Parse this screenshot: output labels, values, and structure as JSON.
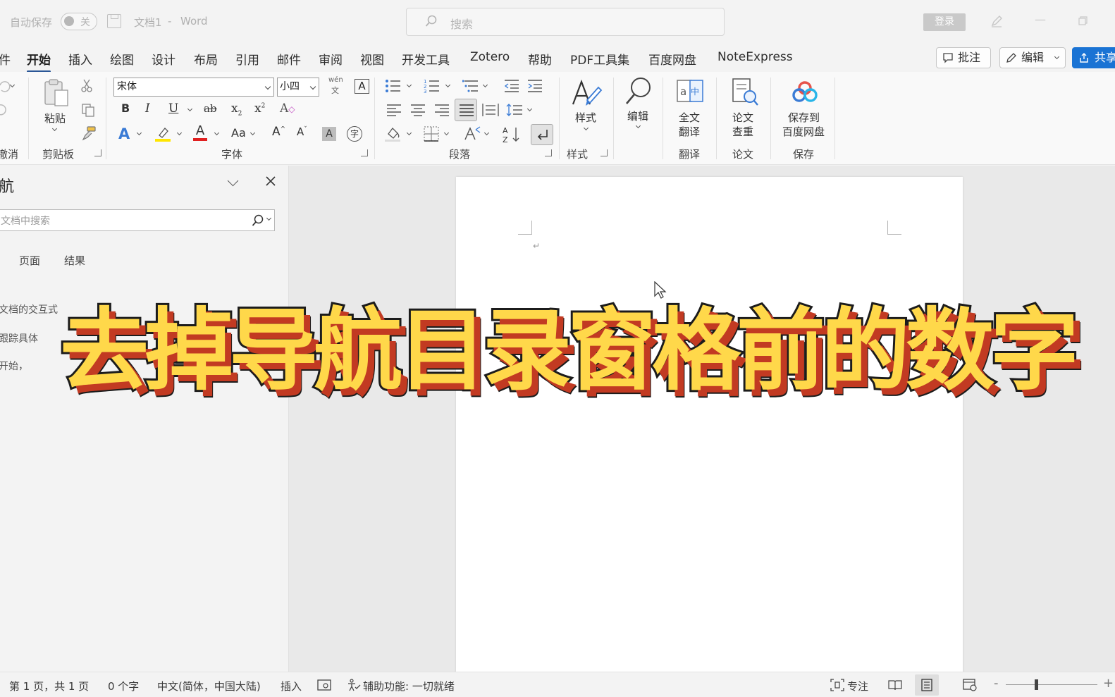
{
  "titlebar": {
    "autosave_label": "自动保存",
    "autosave_state": "关",
    "doc_title": "文档1",
    "separator": "-",
    "app_name": "Word",
    "search_placeholder": "搜索",
    "login_label": "登录"
  },
  "tabs": [
    {
      "label": "件"
    },
    {
      "label": "开始"
    },
    {
      "label": "插入"
    },
    {
      "label": "绘图"
    },
    {
      "label": "设计"
    },
    {
      "label": "布局"
    },
    {
      "label": "引用"
    },
    {
      "label": "邮件"
    },
    {
      "label": "审阅"
    },
    {
      "label": "视图"
    },
    {
      "label": "开发工具"
    },
    {
      "label": "Zotero"
    },
    {
      "label": "帮助"
    },
    {
      "label": "PDF工具集"
    },
    {
      "label": "百度网盘"
    },
    {
      "label": "NoteExpress"
    }
  ],
  "tab_buttons": {
    "comment": "批注",
    "edit": "编辑",
    "share": "共享"
  },
  "ribbon": {
    "undo_group": "撤消",
    "clipboard": {
      "paste": "粘贴",
      "group": "剪贴板"
    },
    "font": {
      "name": "宋体",
      "size": "小四",
      "phonetic_top": "wén",
      "phonetic_bottom": "文",
      "group": "字体"
    },
    "paragraph": {
      "group": "段落"
    },
    "styles": {
      "label": "样式",
      "group": "样式"
    },
    "editing": {
      "label": "编辑"
    },
    "translate": {
      "line1": "全文",
      "line2": "翻译",
      "group": "翻译"
    },
    "paper": {
      "line1": "论文",
      "line2": "查重",
      "group": "论文"
    },
    "save": {
      "line1": "保存到",
      "line2": "百度网盘",
      "group": "保存"
    }
  },
  "nav_pane": {
    "title": "航",
    "search_placeholder": "文档中搜索",
    "tabs": [
      "页面",
      "结果"
    ],
    "text_lines": [
      "文档的交互式",
      "跟踪具体",
      "开始，"
    ]
  },
  "overlay_text": "去掉导航目录窗格前的数字",
  "status": {
    "page": "第 1 页，共 1 页",
    "words": "0 个字",
    "language": "中文(简体，中国大陆)",
    "mode": "插入",
    "accessibility": "辅助功能: 一切就绪",
    "focus": "专注"
  },
  "colors": {
    "accent": "#2b5797",
    "share_button": "#1a73d4",
    "overlay_fill": "#ffd84a",
    "overlay_shadow": "#c23a22"
  }
}
